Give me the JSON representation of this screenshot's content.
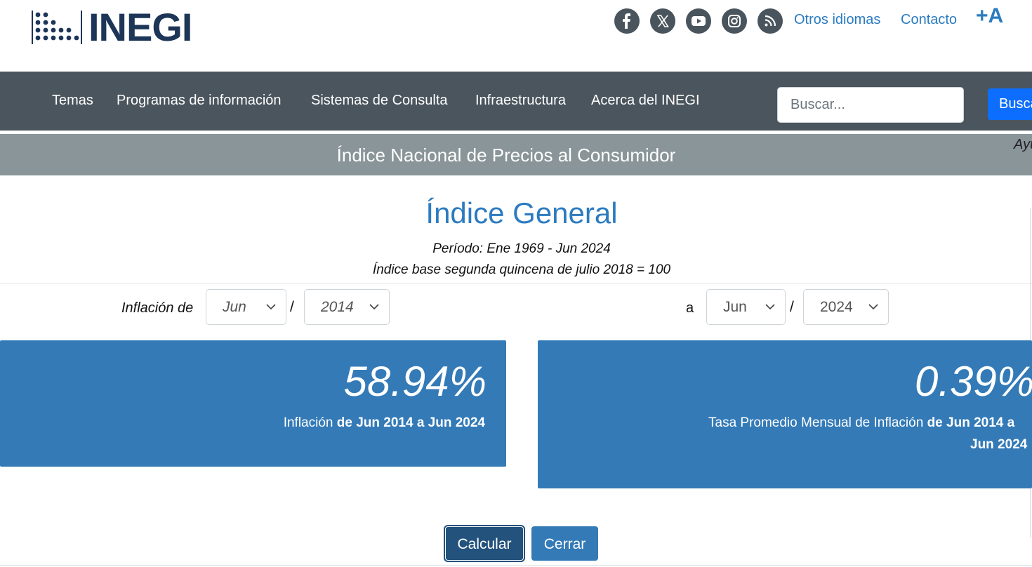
{
  "header": {
    "logo_text": "INEGI",
    "social_icons": [
      "facebook-icon",
      "x-icon",
      "youtube-icon",
      "instagram-icon",
      "rss-icon"
    ],
    "links": {
      "languages": "Otros idiomas",
      "contact": "Contacto",
      "font_size": "+A"
    }
  },
  "nav": {
    "items": [
      "Temas",
      "Programas de información",
      "Sistemas de Consulta",
      "Infraestructura",
      "Acerca del INEGI"
    ],
    "search_placeholder": "Buscar...",
    "search_button": "Buscar"
  },
  "banner": {
    "title": "Índice Nacional de Precios al Consumidor",
    "help": "Ayuda"
  },
  "main": {
    "title": "Índice General",
    "period": "Período: Ene 1969 - Jun 2024",
    "base": "Índice base segunda quincena de julio 2018 = 100",
    "from_label": "Inflación de",
    "to_label": "a",
    "separator": "/",
    "from_month": "Jun",
    "from_year": "2014",
    "to_month": "Jun",
    "to_year": "2024"
  },
  "results": {
    "inflation": {
      "value": "58.94%",
      "label_prefix": "Inflación",
      "label_range": "de Jun 2014 a Jun 2024"
    },
    "monthly": {
      "value": "0.39%",
      "label_prefix": "Tasa Promedio Mensual de Inflación",
      "label_range_1": "de Jun 2014 a",
      "label_range_2": "Jun 2024"
    }
  },
  "buttons": {
    "calculate": "Calcular",
    "close": "Cerrar"
  },
  "colors": {
    "accent": "#2c7bc0",
    "card": "#337ab7",
    "nav": "#4b555d",
    "banner": "#8a9599",
    "primary_button": "#0d6efd"
  }
}
